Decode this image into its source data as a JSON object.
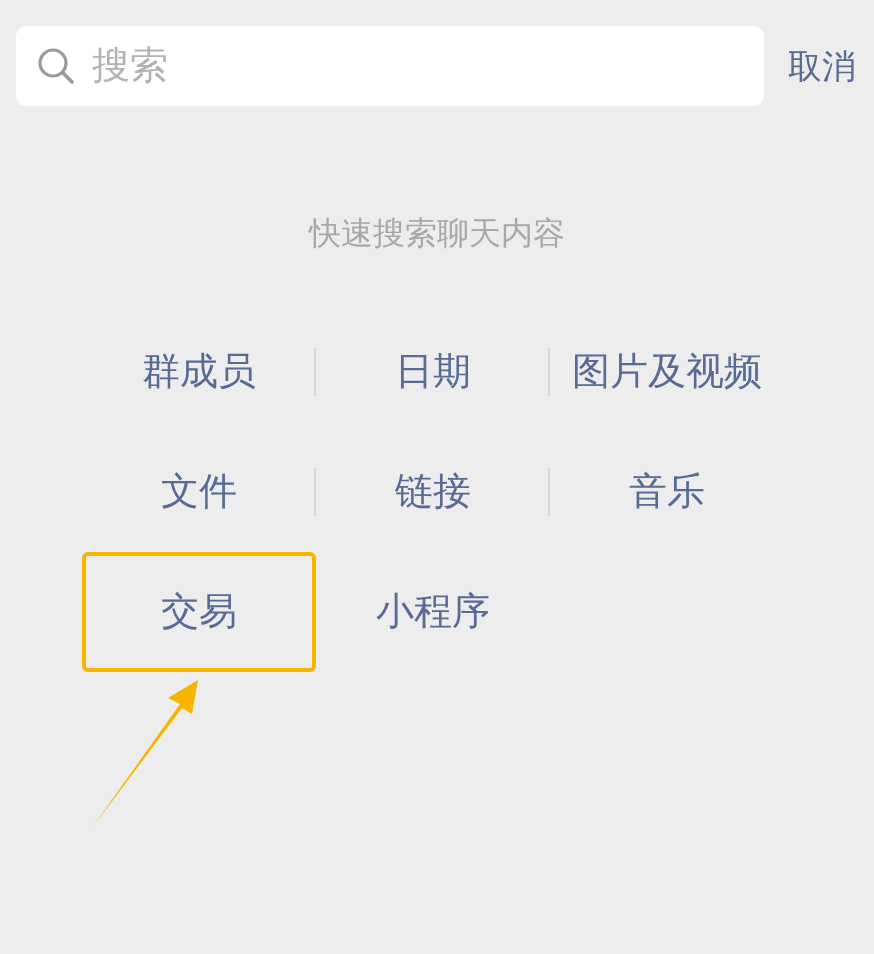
{
  "search": {
    "placeholder": "搜索",
    "cancel": "取消"
  },
  "hint": "快速搜索聊天内容",
  "rows": [
    [
      {
        "label": "群成员",
        "highlighted": false
      },
      {
        "label": "日期",
        "highlighted": false
      },
      {
        "label": "图片及视频",
        "highlighted": false
      }
    ],
    [
      {
        "label": "文件",
        "highlighted": false
      },
      {
        "label": "链接",
        "highlighted": false
      },
      {
        "label": "音乐",
        "highlighted": false
      }
    ],
    [
      {
        "label": "交易",
        "highlighted": true
      },
      {
        "label": "小程序",
        "highlighted": false
      }
    ]
  ],
  "annotation_arrow": true
}
